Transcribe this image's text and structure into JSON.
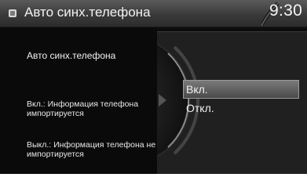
{
  "header": {
    "title": "Авто синх.телефона",
    "time": "9:30",
    "icon": "settings-bullet-icon"
  },
  "info": {
    "heading": "Авто синх.телефона",
    "on_description": "Вкл.: Информация телефона импортируется",
    "off_description": "Выкл.: Информация телефона не импортируется"
  },
  "options": {
    "on_label": "Вкл.",
    "off_label": "Откл.",
    "selected": "Вкл."
  },
  "colors": {
    "background": "#0d0d0d",
    "titlebar": "#3a3a3a",
    "selected_highlight": "#6a6a6a",
    "text": "#f2f2f2"
  }
}
